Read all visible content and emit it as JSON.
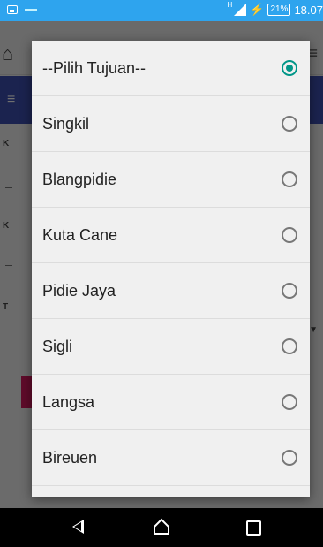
{
  "status_bar": {
    "network": "H",
    "battery": "21%",
    "time": "18.07"
  },
  "background_app": {
    "letters": [
      "K",
      "K",
      "T"
    ]
  },
  "dialog": {
    "options": [
      {
        "label": "--Pilih Tujuan--",
        "checked": true
      },
      {
        "label": "Singkil",
        "checked": false
      },
      {
        "label": "Blangpidie",
        "checked": false
      },
      {
        "label": "Kuta Cane",
        "checked": false
      },
      {
        "label": "Pidie Jaya",
        "checked": false
      },
      {
        "label": "Sigli",
        "checked": false
      },
      {
        "label": "Langsa",
        "checked": false
      },
      {
        "label": "Bireuen",
        "checked": false
      }
    ]
  },
  "colors": {
    "status_bar": "#2ea4ee",
    "radio_accent": "#009688",
    "toolbar": "#3f51b5"
  }
}
